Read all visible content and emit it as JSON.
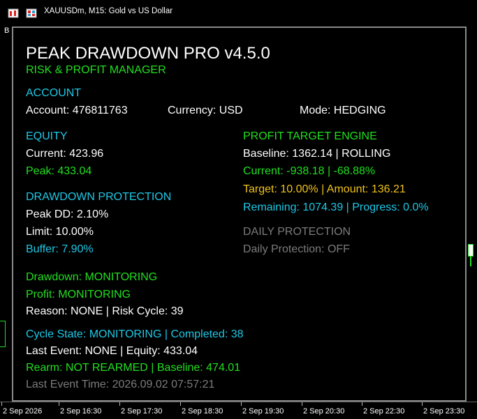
{
  "window": {
    "title": "XAUUSDm, M15:  Gold vs US Dollar",
    "corner_char": "B"
  },
  "panel": {
    "title": "PEAK DRAWDOWN PRO v4.5.0",
    "subtitle": "RISK & PROFIT MANAGER",
    "account": {
      "header": "ACCOUNT",
      "account": "Account: 476811763",
      "currency": "Currency: USD",
      "mode": "Mode: HEDGING"
    },
    "equity": {
      "header": "EQUITY",
      "current": "Current: 423.96",
      "peak": "Peak: 433.04"
    },
    "drawdown": {
      "header": "DRAWDOWN PROTECTION",
      "peak_dd": "Peak DD: 2.10%",
      "limit": "Limit: 10.00%",
      "buffer": "Buffer: 7.90%"
    },
    "profit_target": {
      "header": "PROFIT TARGET ENGINE",
      "baseline": "Baseline: 1362.14 | ROLLING",
      "current": "Current: -938.18 | -68.88%",
      "target": "Target: 10.00% | Amount: 136.21",
      "remaining": "Remaining: 1074.39 | Progress: 0.0%"
    },
    "daily": {
      "header": "DAILY PROTECTION",
      "status": "Daily Protection: OFF"
    },
    "status": {
      "drawdown": "Drawdown: MONITORING",
      "profit": "Profit: MONITORING",
      "reason": "Reason: NONE  |  Risk Cycle: 39",
      "cycle_state": "Cycle State: MONITORING | Completed: 38",
      "last_event": "Last Event: NONE | Equity: 433.04",
      "rearm": "Rearm: NOT REARMED | Baseline: 474.01",
      "last_event_time": "Last Event Time: 2026.09.02 07:57:21"
    }
  },
  "time_axis": {
    "labels": [
      "2 Sep 2026",
      "2 Sep 16:30",
      "2 Sep 17:30",
      "2 Sep 18:30",
      "2 Sep 19:30",
      "2 Sep 20:30",
      "2 Sep 22:30",
      "2 Sep 23:30"
    ]
  },
  "colors": {
    "background": "#000000",
    "title": "#ffffff",
    "green": "#22e01f",
    "cyan": "#1ec8e6",
    "orange": "#f0c21a",
    "gray": "#7c7c7c",
    "bull_candle": "#22e01f"
  }
}
